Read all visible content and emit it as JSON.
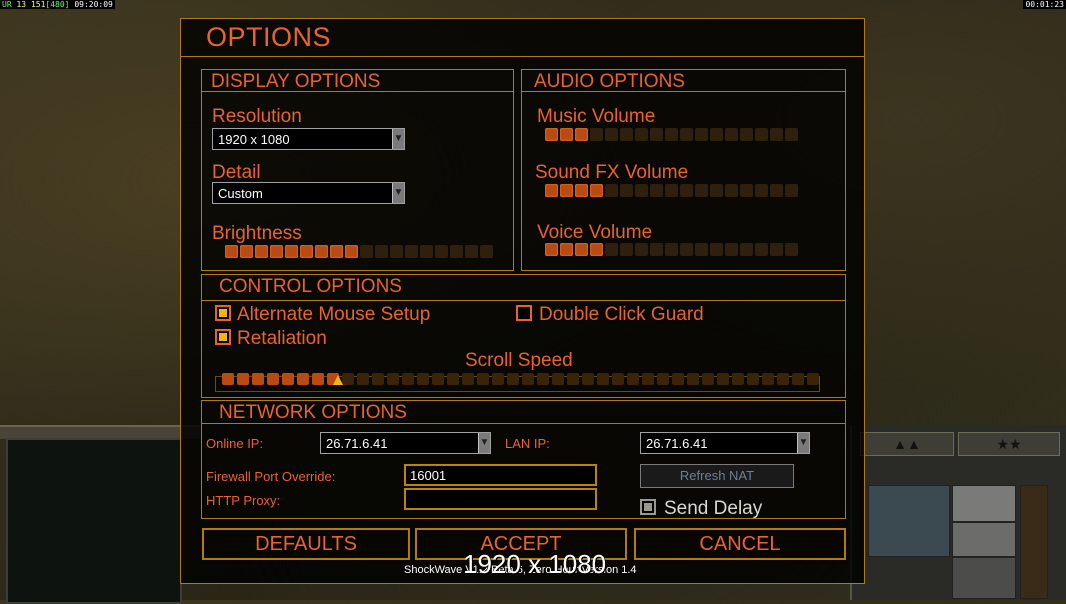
{
  "hud": {
    "top_left_a": "UR",
    "top_left_b": "13",
    "top_left_c": "151",
    "top_left_d": "[480]",
    "top_left_time": "09:20:09",
    "top_right_time": "00:01:23"
  },
  "dialog": {
    "title": "OPTIONS",
    "display": {
      "title": "DISPLAY OPTIONS",
      "resolution_label": "Resolution",
      "resolution_value": "1920 x 1080",
      "detail_label": "Detail",
      "detail_value": "Custom",
      "brightness_label": "Brightness",
      "brightness_level": 0.5
    },
    "audio": {
      "title": "AUDIO OPTIONS",
      "music_label": "Music Volume",
      "music_level": 0.17,
      "sfx_label": "Sound FX Volume",
      "sfx_level": 0.24,
      "voice_label": "Voice Volume",
      "voice_level": 0.24
    },
    "control": {
      "title": "CONTROL OPTIONS",
      "alt_mouse_label": "Alternate Mouse Setup",
      "alt_mouse_checked": true,
      "double_click_label": "Double Click Guard",
      "double_click_checked": false,
      "retaliation_label": "Retaliation",
      "retaliation_checked": true,
      "scroll_speed_label": "Scroll Speed",
      "scroll_speed_level": 0.2
    },
    "network": {
      "title": "NETWORK OPTIONS",
      "online_ip_label": "Online IP:",
      "online_ip_value": "26.71.6.41",
      "lan_ip_label": "LAN IP:",
      "lan_ip_value": "26.71.6.41",
      "firewall_label": "Firewall Port Override:",
      "firewall_value": "16001",
      "proxy_label": "HTTP Proxy:",
      "proxy_value": "",
      "refresh_nat_label": "Refresh NAT",
      "send_delay_label": "Send Delay",
      "send_delay_checked": true
    },
    "buttons": {
      "defaults": "DEFAULTS",
      "accept": "ACCEPT",
      "cancel": "CANCEL"
    },
    "footer": "ShockWave  V1.2 Beta 6, Zero Hour Version 1.4",
    "overlay_resolution": "1920 x 1080"
  },
  "colors": {
    "accent": "#e8642a",
    "border": "#b07a14",
    "slider_on": "#b84a12",
    "check_fill": "#f5b21a"
  }
}
